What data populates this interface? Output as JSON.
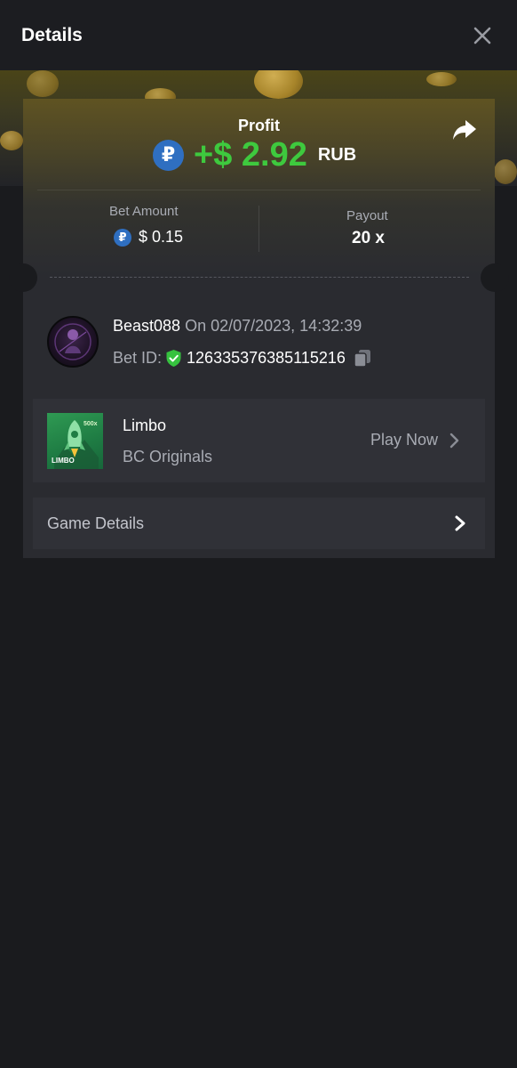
{
  "header": {
    "title": "Details"
  },
  "summary": {
    "profit_label": "Profit",
    "currency_symbol": "₽",
    "profit_amount": "+$ 2.92",
    "profit_currency": "RUB",
    "bet_amount_label": "Bet Amount",
    "bet_amount_value": "$ 0.15",
    "payout_label": "Payout",
    "payout_value": "20 x"
  },
  "bet": {
    "username": "Beast088",
    "date_text": " On 02/07/2023, 14:32:39",
    "bet_id_label": "Bet ID:",
    "bet_id_value": "126335376385115216"
  },
  "game": {
    "name": "Limbo",
    "provider": "BC Originals",
    "play_now_label": "Play Now",
    "thumb_label": "LIMBO",
    "thumb_badge": "500x"
  },
  "game_details": {
    "label": "Game Details"
  },
  "icons": {
    "close": "close-icon",
    "share": "share-icon",
    "currency": "rub-coin-icon",
    "verified": "shield-check-icon",
    "copy": "copy-icon",
    "chevron": "chevron-right-icon"
  },
  "colors": {
    "background": "#1a1b1e",
    "card": "#2a2b30",
    "row": "#303137",
    "profit_green": "#3ec93e",
    "rub_blue": "#2f6fc1",
    "muted_text": "#a9acb4"
  }
}
